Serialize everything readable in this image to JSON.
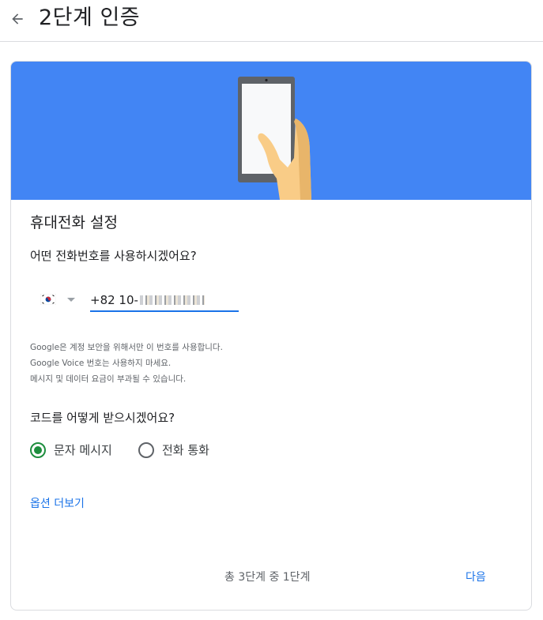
{
  "header": {
    "title": "2단계 인증",
    "back_icon": "arrow-back-icon"
  },
  "banner": {
    "color": "#4285f4",
    "illustration": "phone-in-hand"
  },
  "phone_setup": {
    "title": "휴대전화 설정",
    "question": "어떤 전화번호를 사용하시겠어요?",
    "country": "KR",
    "phone_prefix": "+82 10-",
    "phone_masked": true,
    "notes": [
      "Google은 계정 보안을 위해서만 이 번호를 사용합니다.",
      "Google Voice 번호는 사용하지 마세요.",
      "메시지 및 데이터 요금이 부과될 수 있습니다."
    ]
  },
  "delivery": {
    "question": "코드를 어떻게 받으시겠어요?",
    "options": [
      {
        "label": "문자 메시지",
        "selected": true
      },
      {
        "label": "전화 통화",
        "selected": false
      }
    ]
  },
  "more_options": "옵션 더보기",
  "footer": {
    "step": "총 3단계 중 1단계",
    "next": "다음"
  },
  "colors": {
    "accent": "#1a73e8",
    "radio_checked": "#1e8e3e"
  }
}
